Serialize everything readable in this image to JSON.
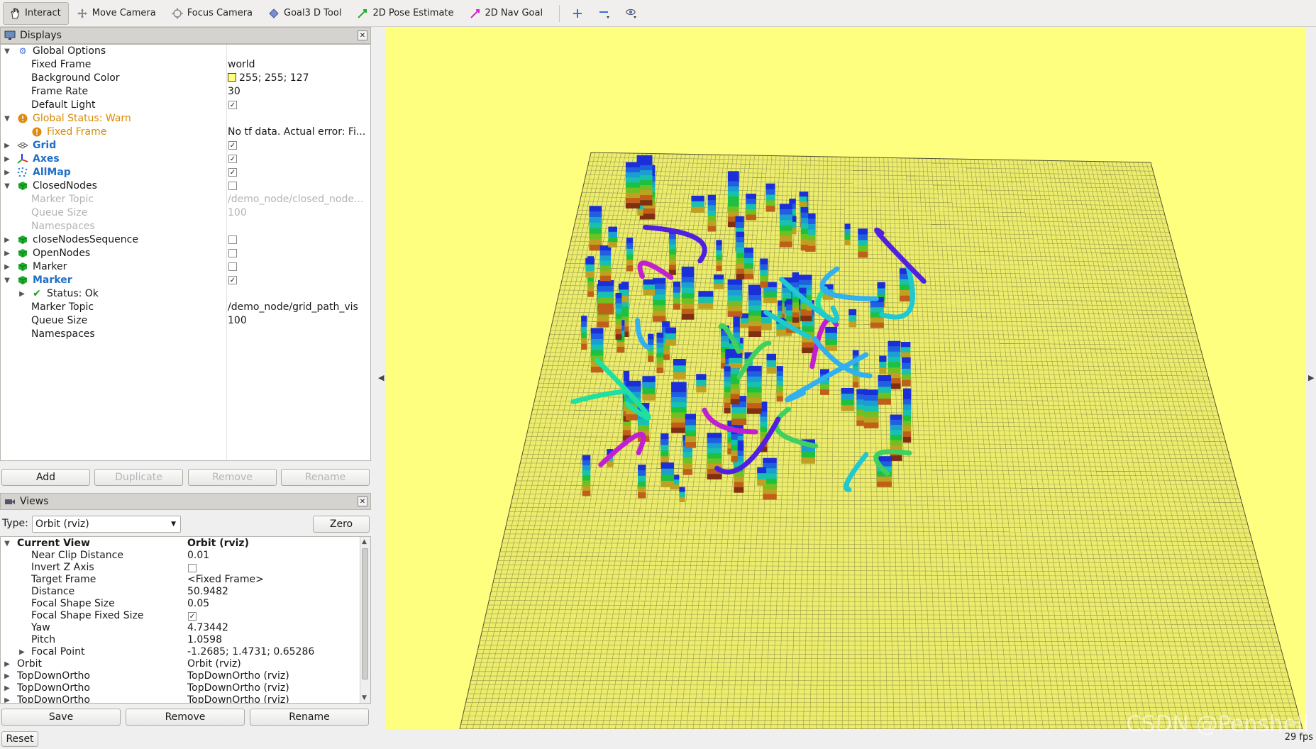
{
  "toolbar": {
    "tools": [
      {
        "label": "Interact",
        "icon": "hand-icon",
        "active": true
      },
      {
        "label": "Move Camera",
        "icon": "move-camera-icon"
      },
      {
        "label": "Focus Camera",
        "icon": "focus-camera-icon"
      },
      {
        "label": "Goal3 D Tool",
        "icon": "goal3d-icon"
      },
      {
        "label": "2D Pose Estimate",
        "icon": "pose-estimate-icon",
        "color": "#22aa22"
      },
      {
        "label": "2D Nav Goal",
        "icon": "nav-goal-icon",
        "color": "#d020d0"
      }
    ]
  },
  "displays": {
    "title": "Displays",
    "global_options": {
      "label": "Global Options"
    },
    "fixed_frame": {
      "label": "Fixed Frame",
      "value": "world"
    },
    "background_color": {
      "label": "Background Color",
      "value": "255; 255; 127",
      "swatch": "#ffff7f"
    },
    "frame_rate": {
      "label": "Frame Rate",
      "value": "30"
    },
    "default_light": {
      "label": "Default Light",
      "checked": true
    },
    "global_status": {
      "label": "Global Status: Warn"
    },
    "status_fixed_frame": {
      "label": "Fixed Frame",
      "value": "No tf data.  Actual error: Fi..."
    },
    "grid": {
      "label": "Grid",
      "checked": true
    },
    "axes": {
      "label": "Axes",
      "checked": true
    },
    "allmap": {
      "label": "AllMap",
      "checked": true
    },
    "closed_nodes": {
      "label": "ClosedNodes",
      "checked": false
    },
    "closed_marker_topic": {
      "label": "Marker Topic",
      "value": "/demo_node/closed_node..."
    },
    "closed_queue_size": {
      "label": "Queue Size",
      "value": "100"
    },
    "closed_namespaces": {
      "label": "Namespaces"
    },
    "close_nodes_sequence": {
      "label": "closeNodesSequence",
      "checked": false
    },
    "open_nodes": {
      "label": "OpenNodes",
      "checked": false
    },
    "marker1": {
      "label": "Marker",
      "checked": false
    },
    "marker2": {
      "label": "Marker",
      "checked": true
    },
    "marker_status": {
      "label": "Status: Ok"
    },
    "marker_topic": {
      "label": "Marker Topic",
      "value": "/demo_node/grid_path_vis"
    },
    "marker_queue_size": {
      "label": "Queue Size",
      "value": "100"
    },
    "marker_namespaces": {
      "label": "Namespaces"
    },
    "buttons": {
      "add": "Add",
      "duplicate": "Duplicate",
      "remove": "Remove",
      "rename": "Rename"
    }
  },
  "views": {
    "title": "Views",
    "type_label": "Type:",
    "type_value": "Orbit (rviz)",
    "zero": "Zero",
    "current_view": {
      "label": "Current View",
      "value": "Orbit (rviz)"
    },
    "props": [
      {
        "label": "Near Clip Distance",
        "value": "0.01"
      },
      {
        "label": "Invert Z Axis",
        "checkbox": true,
        "checked": false
      },
      {
        "label": "Target Frame",
        "value": "<Fixed Frame>"
      },
      {
        "label": "Distance",
        "value": "50.9482"
      },
      {
        "label": "Focal Shape Size",
        "value": "0.05"
      },
      {
        "label": "Focal Shape Fixed Size",
        "checkbox": true,
        "checked": true
      },
      {
        "label": "Yaw",
        "value": "4.73442"
      },
      {
        "label": "Pitch",
        "value": "1.0598"
      },
      {
        "label": "Focal Point",
        "value": "-1.2685; 1.4731; 0.65286",
        "expandable": true
      }
    ],
    "saved": [
      {
        "label": "Orbit",
        "value": "Orbit (rviz)"
      },
      {
        "label": "TopDownOrtho",
        "value": "TopDownOrtho (rviz)"
      },
      {
        "label": "TopDownOrtho",
        "value": "TopDownOrtho (rviz)"
      },
      {
        "label": "TopDownOrtho",
        "value": "TopDownOrtho (rviz)"
      }
    ],
    "buttons": {
      "save": "Save",
      "remove": "Remove",
      "rename": "Rename"
    }
  },
  "reset": "Reset",
  "fps": "29 fps",
  "watermark": "CSDN @Penshell",
  "viewport": {
    "background": "#ffff7f",
    "grid_color": "#555533"
  }
}
